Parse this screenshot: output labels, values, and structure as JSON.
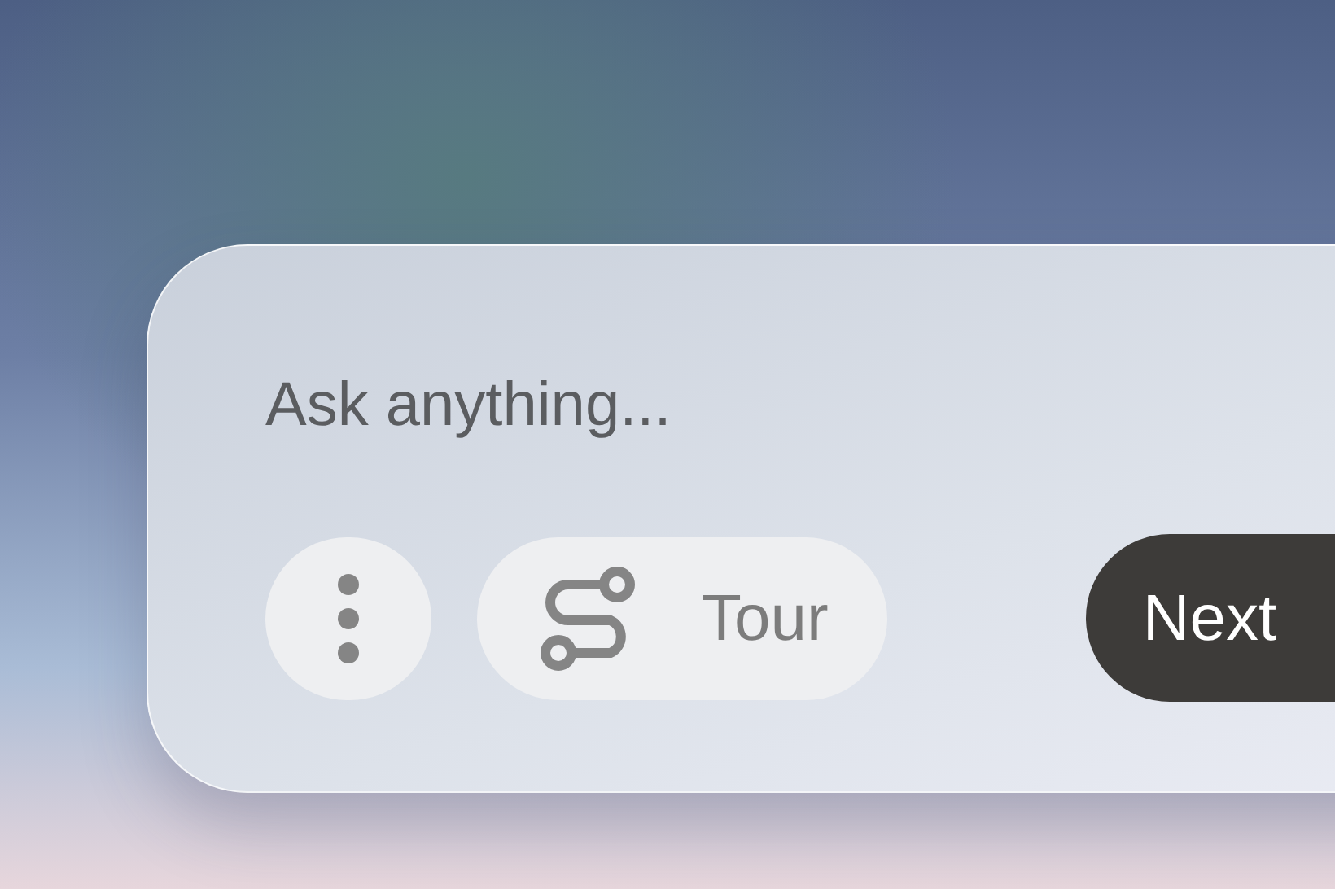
{
  "prompt": {
    "placeholder": "Ask anything..."
  },
  "buttons": [
    {
      "kind": "menu"
    },
    {
      "kind": "pill",
      "label": "Tour"
    },
    {
      "kind": "primary",
      "label": "Next"
    }
  ]
}
